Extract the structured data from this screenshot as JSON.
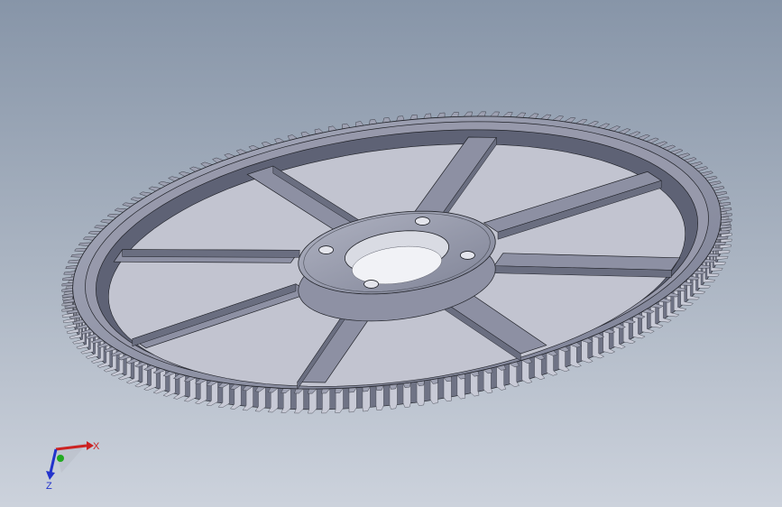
{
  "viewport": {
    "background_top": "#8795a8",
    "background_bottom": "#ccd2dc"
  },
  "model": {
    "icon": "spur-gear-model",
    "spokes": 8,
    "bolt_holes": 4,
    "teeth_count": 150,
    "colors": {
      "tooth_light": "#c8cad6",
      "tooth_dark": "#6f7385",
      "face": "#8a8ea2",
      "rim_inner": "#5e6275",
      "hub": "#9a9db0",
      "web_light": "#c2c4d0",
      "line": "#202228"
    }
  },
  "triad": {
    "x_label": "X",
    "z_label": "Z",
    "x_color": "#cc2222",
    "y_color": "#22aa22",
    "z_color": "#2233cc"
  }
}
